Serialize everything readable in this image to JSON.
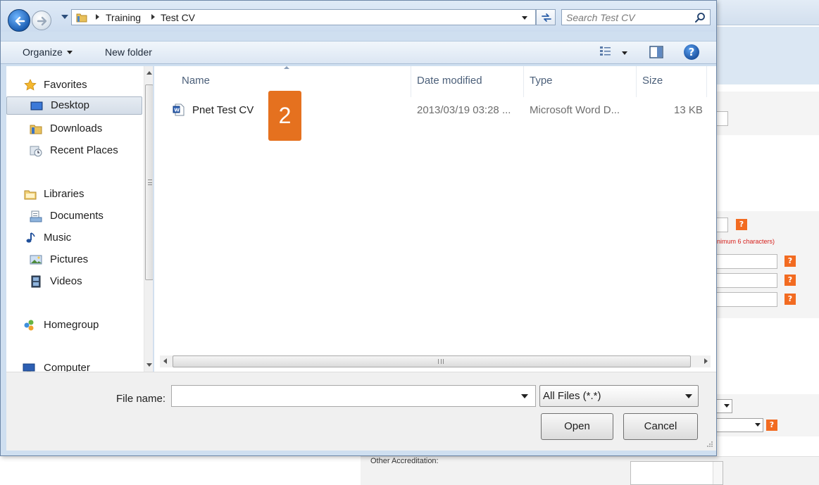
{
  "dialog": {
    "breadcrumbs": [
      "Training",
      "Test CV"
    ],
    "search": {
      "placeholder": "Search Test CV"
    },
    "toolbar": {
      "organize_label": "Organize",
      "new_folder_label": "New folder"
    },
    "navigation": {
      "favorites_heading": "Favorites",
      "favorites": [
        "Desktop",
        "Downloads",
        "Recent Places"
      ],
      "libraries_heading": "Libraries",
      "libraries": [
        "Documents",
        "Music",
        "Pictures",
        "Videos"
      ],
      "homegroup": "Homegroup",
      "computer": "Computer",
      "selected": "Desktop"
    },
    "columns": [
      "Name",
      "Date modified",
      "Type",
      "Size"
    ],
    "files": [
      {
        "name": "Pnet Test CV",
        "date": "2013/03/19 03:28 ...",
        "type": "Microsoft Word D...",
        "size": "13 KB",
        "icon": "word-document-icon"
      }
    ],
    "step_badge": "2",
    "file_name_label": "File name:",
    "file_name_value": "",
    "file_type_value": "All Files (*.*)",
    "open_label": "Open",
    "cancel_label": "Cancel"
  },
  "background_page": {
    "hint_text": "inimum 6 characters)",
    "help_glyph": "?",
    "other_accreditation_label": "Other Accreditation:",
    "accent_color": "#f26b21",
    "hint_color": "#d6201c"
  }
}
